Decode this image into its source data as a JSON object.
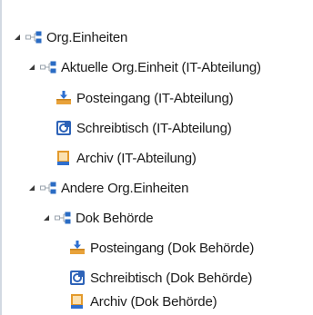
{
  "tree": {
    "org_units": {
      "label": "Org.Einheiten",
      "icon": "org-unit-icon",
      "expanded": true,
      "current": {
        "label": "Aktuelle Org.Einheit (IT-Abteilung)",
        "icon": "org-unit-icon",
        "expanded": true,
        "items": [
          {
            "label": "Posteingang (IT-Abteilung)",
            "icon": "inbox-icon"
          },
          {
            "label": "Schreibtisch (IT-Abteilung)",
            "icon": "desk-icon"
          },
          {
            "label": "Archiv (IT-Abteilung)",
            "icon": "archive-icon"
          }
        ]
      },
      "other": {
        "label": "Andere Org.Einheiten",
        "icon": "org-unit-icon",
        "expanded": true,
        "dok": {
          "label": "Dok Behörde",
          "icon": "org-unit-icon",
          "expanded": true,
          "items": [
            {
              "label": "Posteingang (Dok Behörde)",
              "icon": "inbox-icon"
            },
            {
              "label": "Schreibtisch (Dok Behörde)",
              "icon": "desk-icon"
            },
            {
              "label": "Archiv (Dok Behörde)",
              "icon": "archive-icon"
            }
          ]
        }
      }
    }
  },
  "colors": {
    "text": "#1b1b1b",
    "toggle": "#3a3a3a",
    "org_icon_blue": "#2b6cc4",
    "org_icon_gray": "#9aa3ad",
    "inbox_orange": "#e8a23a",
    "inbox_blue": "#2d6fd1",
    "desk_blue": "#2e63b8",
    "archive_orange": "#e39a2c",
    "archive_blue": "#2f6fce"
  }
}
